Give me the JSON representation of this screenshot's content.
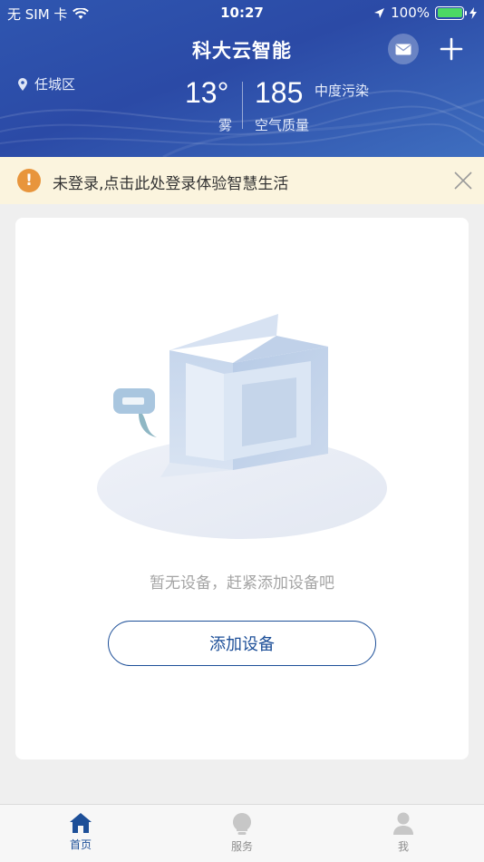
{
  "status_bar": {
    "carrier": "无 SIM 卡",
    "time": "10:27",
    "battery": "100%"
  },
  "header": {
    "title": "科大云智能",
    "location": "任城区",
    "temperature": "13°",
    "weather": "雾",
    "aqi_value": "185",
    "aqi_level": "中度污染",
    "aqi_label": "空气质量"
  },
  "notice": {
    "text": "未登录,点击此处登录体验智慧生活",
    "icon": "exclamation-icon"
  },
  "empty_state": {
    "message": "暂无设备，赶紧添加设备吧",
    "add_button": "添加设备"
  },
  "tabs": [
    {
      "label": "首页",
      "icon": "home-icon",
      "active": true
    },
    {
      "label": "服务",
      "icon": "lightbulb-icon",
      "active": false
    },
    {
      "label": "我",
      "icon": "user-icon",
      "active": false
    }
  ],
  "colors": {
    "header_bg": "#2b4aa6",
    "accent": "#1d4f98",
    "notice_bg": "#fbf4de",
    "notice_icon": "#e8953c"
  }
}
